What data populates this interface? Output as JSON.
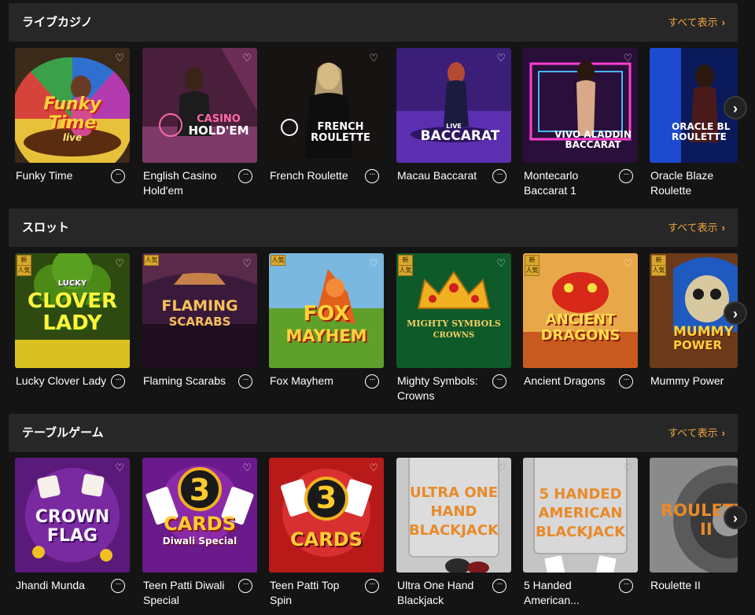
{
  "sections": [
    {
      "title": "ライブカジノ",
      "view_all": "すべて表示",
      "games": [
        {
          "name": "Funky Time",
          "art": [
            "Funky",
            "Time",
            "live"
          ],
          "badges": []
        },
        {
          "name": "English Casino Hold'em",
          "art": [
            "CASINO",
            "HOLD'EM"
          ],
          "badges": []
        },
        {
          "name": "French Roulette",
          "art": [
            "FRENCH",
            "ROULETTE"
          ],
          "badges": []
        },
        {
          "name": "Macau Baccarat",
          "art": [
            "LIVE",
            "BACCARAT"
          ],
          "badges": []
        },
        {
          "name": "Montecarlo Baccarat 1",
          "art": [
            "VIVO ALADDIN",
            "BACCARAT"
          ],
          "badges": []
        },
        {
          "name": "Oracle Blaze Roulette",
          "art": [
            "ORACLE BL",
            "ROULETTE"
          ],
          "badges": []
        }
      ]
    },
    {
      "title": "スロット",
      "view_all": "すべて表示",
      "games": [
        {
          "name": "Lucky Clover Lady",
          "art": [
            "LUCKY",
            "CLOVER",
            "LADY"
          ],
          "badges": [
            "新",
            "人気"
          ]
        },
        {
          "name": "Flaming Scarabs",
          "art": [
            "FLAMING",
            "SCARABS"
          ],
          "badges": [
            "人気"
          ]
        },
        {
          "name": "Fox Mayhem",
          "art": [
            "FOX",
            "MAYHEM"
          ],
          "badges": [
            "人気"
          ]
        },
        {
          "name": "Mighty Symbols: Crowns",
          "art": [
            "MIGHTY SYMBOLS",
            "CROWNS"
          ],
          "badges": [
            "新",
            "人気"
          ]
        },
        {
          "name": "Ancient Dragons",
          "art": [
            "ANCIENT",
            "DRAGONS"
          ],
          "badges": [
            "新",
            "人気"
          ]
        },
        {
          "name": "Mummy Power",
          "art": [
            "MUMMY",
            "POWER"
          ],
          "badges": [
            "新",
            "人気"
          ]
        }
      ]
    },
    {
      "title": "テーブルゲーム",
      "view_all": "すべて表示",
      "games": [
        {
          "name": "Jhandi Munda",
          "art": [
            "CROWN",
            "FLAG"
          ],
          "badges": []
        },
        {
          "name": "Teen Patti Diwali Special",
          "art": [
            "3",
            "CARDS",
            "Diwali Special"
          ],
          "badges": []
        },
        {
          "name": "Teen Patti Top Spin",
          "art": [
            "3",
            "CARDS"
          ],
          "badges": []
        },
        {
          "name": "Ultra One Hand Blackjack",
          "art": [
            "ULTRA ONE",
            "HAND",
            "BLACKJACK"
          ],
          "badges": []
        },
        {
          "name": "5 Handed American...",
          "art": [
            "5 HANDED",
            "AMERICAN",
            "BLACKJACK"
          ],
          "badges": []
        },
        {
          "name": "Roulette II",
          "art": [
            "ROULETTE",
            "II"
          ],
          "badges": []
        }
      ]
    }
  ],
  "icons": {
    "favorite": "heart-icon",
    "info": "more-info-icon",
    "next": "chevron-right-icon"
  },
  "colors": {
    "background": "#141414",
    "header_bar": "#272727",
    "accent": "#e8a33d"
  }
}
